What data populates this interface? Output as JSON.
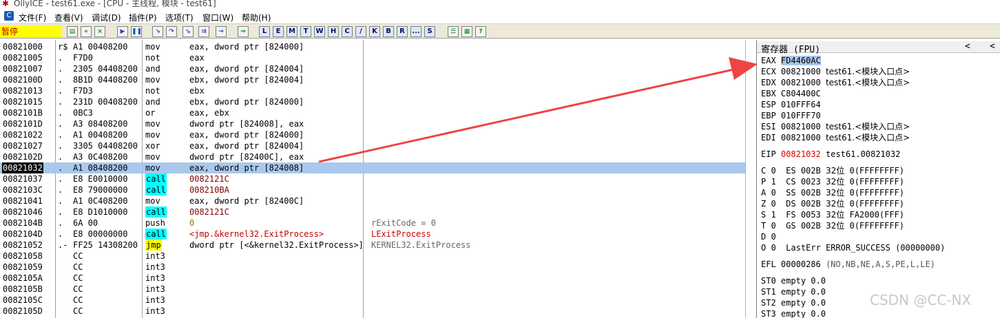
{
  "window": {
    "title": "OllyICE - test61.exe - [CPU - 主线程, 模块 - test61]"
  },
  "menu": [
    "文件(F)",
    "查看(V)",
    "调试(D)",
    "插件(P)",
    "选项(T)",
    "窗口(W)",
    "帮助(H)"
  ],
  "toolbar": {
    "state": "暂停",
    "letters": [
      "L",
      "E",
      "M",
      "T",
      "W",
      "H",
      "C",
      "/",
      "K",
      "B",
      "R",
      "...",
      "S"
    ]
  },
  "disasm": {
    "rows": [
      {
        "addr": "00821000",
        "mark": "r$",
        "hex": "A1 00408200",
        "mn": "mov",
        "op": "eax, dword ptr [824000]",
        "cm": ""
      },
      {
        "addr": "00821005",
        "mark": ".",
        "hex": "F7D0",
        "mn": "not",
        "op": "eax",
        "cm": ""
      },
      {
        "addr": "00821007",
        "mark": ".",
        "hex": "2305 04408200",
        "mn": "and",
        "op": "eax, dword ptr [824004]",
        "cm": ""
      },
      {
        "addr": "0082100D",
        "mark": ".",
        "hex": "8B1D 04408200",
        "mn": "mov",
        "op": "ebx, dword ptr [824004]",
        "cm": ""
      },
      {
        "addr": "00821013",
        "mark": ".",
        "hex": "F7D3",
        "mn": "not",
        "op": "ebx",
        "cm": ""
      },
      {
        "addr": "00821015",
        "mark": ".",
        "hex": "231D 00408200",
        "mn": "and",
        "op": "ebx, dword ptr [824000]",
        "cm": ""
      },
      {
        "addr": "0082101B",
        "mark": ".",
        "hex": "0BC3",
        "mn": "or",
        "op": "eax, ebx",
        "cm": ""
      },
      {
        "addr": "0082101D",
        "mark": ".",
        "hex": "A3 08408200",
        "mn": "mov",
        "op": "dword ptr [824008], eax",
        "cm": ""
      },
      {
        "addr": "00821022",
        "mark": ".",
        "hex": "A1 00408200",
        "mn": "mov",
        "op": "eax, dword ptr [824000]",
        "cm": ""
      },
      {
        "addr": "00821027",
        "mark": ".",
        "hex": "3305 04408200",
        "mn": "xor",
        "op": "eax, dword ptr [824004]",
        "cm": ""
      },
      {
        "addr": "0082102D",
        "mark": ".",
        "hex": "A3 0C408200",
        "mn": "mov",
        "op": "dword ptr [82400C], eax",
        "cm": ""
      },
      {
        "addr": "00821032",
        "mark": ".",
        "hex": "A1 08408200",
        "mn": "mov",
        "op": "eax, dword ptr [824008]",
        "cm": "",
        "sel": true
      },
      {
        "addr": "00821037",
        "mark": ".",
        "hex": "E8 E0010000",
        "mn": "call",
        "op": "0082121C",
        "cm": "",
        "type": "call"
      },
      {
        "addr": "0082103C",
        "mark": ".",
        "hex": "E8 79000000",
        "mn": "call",
        "op": "008210BA",
        "cm": "",
        "type": "call"
      },
      {
        "addr": "00821041",
        "mark": ".",
        "hex": "A1 0C408200",
        "mn": "mov",
        "op": "eax, dword ptr [82400C]",
        "cm": ""
      },
      {
        "addr": "00821046",
        "mark": ".",
        "hex": "E8 D1010000",
        "mn": "call",
        "op": "0082121C",
        "cm": "",
        "type": "call"
      },
      {
        "addr": "0082104B",
        "mark": ".",
        "hex": "6A 00",
        "mn": "push",
        "op": "0",
        "cm": "rExitCode = 0",
        "type": "push"
      },
      {
        "addr": "0082104D",
        "mark": ".",
        "hex": "E8 00000000",
        "mn": "call",
        "op": "<jmp.&kernel32.ExitProcess>",
        "cm": "LExitProcess",
        "type": "callx"
      },
      {
        "addr": "00821052",
        "mark": ".-",
        "hex": "FF25 14308200",
        "mn": "jmp",
        "op": "dword ptr [<&kernel32.ExitProcess>]",
        "cm": "KERNEL32.ExitProcess",
        "type": "jmp"
      },
      {
        "addr": "00821058",
        "mark": "",
        "hex": "CC",
        "mn": "int3",
        "op": "",
        "cm": ""
      },
      {
        "addr": "00821059",
        "mark": "",
        "hex": "CC",
        "mn": "int3",
        "op": "",
        "cm": ""
      },
      {
        "addr": "0082105A",
        "mark": "",
        "hex": "CC",
        "mn": "int3",
        "op": "",
        "cm": ""
      },
      {
        "addr": "0082105B",
        "mark": "",
        "hex": "CC",
        "mn": "int3",
        "op": "",
        "cm": ""
      },
      {
        "addr": "0082105C",
        "mark": "",
        "hex": "CC",
        "mn": "int3",
        "op": "",
        "cm": ""
      },
      {
        "addr": "0082105D",
        "mark": "",
        "hex": "CC",
        "mn": "int3",
        "op": "",
        "cm": ""
      }
    ]
  },
  "registers": {
    "header": "寄存器 (FPU)",
    "nav_left": "<",
    "nav_right": "<",
    "eax": {
      "name": "EAX",
      "value": "FD4460AC"
    },
    "ecx": {
      "name": "ECX",
      "value": "00821000",
      "note": "test61.<模块入口点>"
    },
    "edx": {
      "name": "EDX",
      "value": "00821000",
      "note": "test61.<模块入口点>"
    },
    "ebx": {
      "name": "EBX",
      "value": "C804400C"
    },
    "esp": {
      "name": "ESP",
      "value": "010FFF64"
    },
    "ebp": {
      "name": "EBP",
      "value": "010FFF70"
    },
    "esi": {
      "name": "ESI",
      "value": "00821000",
      "note": "test61.<模块入口点>"
    },
    "edi": {
      "name": "EDI",
      "value": "00821000",
      "note": "test61.<模块入口点>"
    },
    "eip": {
      "name": "EIP",
      "value": "00821032",
      "note": "test61.00821032"
    },
    "flags": [
      {
        "f": "C 0",
        "seg": "ES 002B",
        "bits": "32位",
        "base": "0(FFFFFFFF)"
      },
      {
        "f": "P 1",
        "seg": "CS 0023",
        "bits": "32位",
        "base": "0(FFFFFFFF)"
      },
      {
        "f": "A 0",
        "seg": "SS 002B",
        "bits": "32位",
        "base": "0(FFFFFFFF)"
      },
      {
        "f": "Z 0",
        "seg": "DS 002B",
        "bits": "32位",
        "base": "0(FFFFFFFF)"
      },
      {
        "f": "S 1",
        "seg": "FS 0053",
        "bits": "32位",
        "base": "FA2000(FFF)"
      },
      {
        "f": "T 0",
        "seg": "GS 002B",
        "bits": "32位",
        "base": "0(FFFFFFFF)"
      }
    ],
    "d": "D 0",
    "o": "O 0",
    "lasterr": "LastErr ERROR_SUCCESS (00000000)",
    "efl": {
      "name": "EFL",
      "value": "00000286",
      "note": "(NO,NB,NE,A,S,PE,L,LE)"
    },
    "st": [
      {
        "name": "ST0",
        "value": "empty 0.0"
      },
      {
        "name": "ST1",
        "value": "empty 0.0"
      },
      {
        "name": "ST2",
        "value": "empty 0.0"
      },
      {
        "name": "ST3",
        "value": "empty 0.0"
      }
    ]
  },
  "watermark": "CSDN @CC-NX",
  "colors": {
    "arrow": "#ee4444",
    "selection": "#a9c8ec",
    "call_bg": "#00ffff",
    "jmp_bg": "#ffff00",
    "state_bg": "#ffff00"
  }
}
